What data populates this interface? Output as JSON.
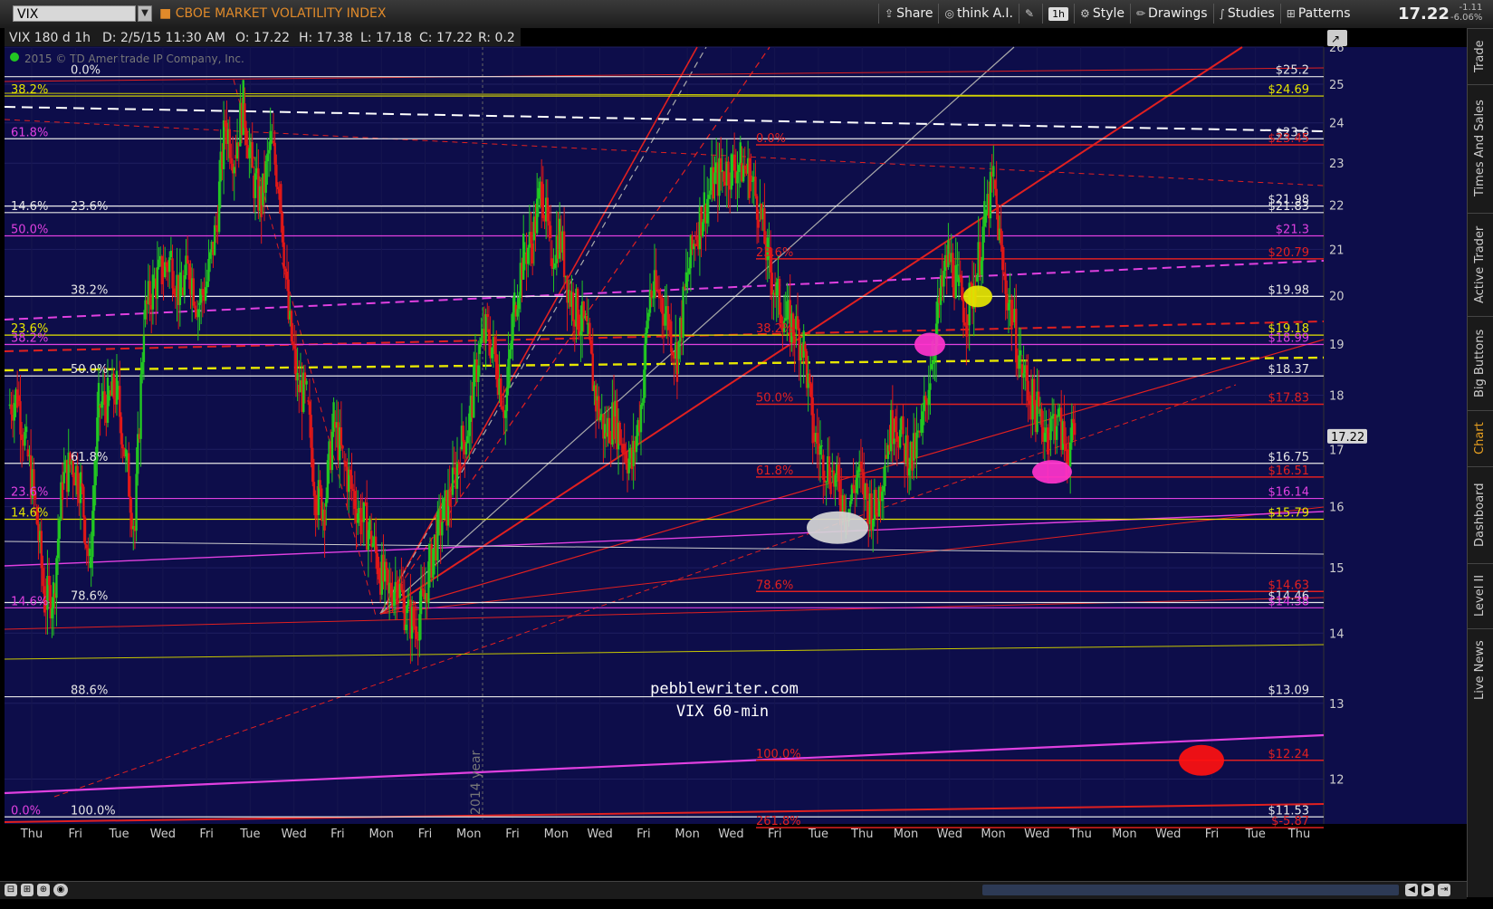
{
  "toolbar": {
    "symbol": "VIX",
    "instrument_name": "CBOE MARKET VOLATILITY INDEX",
    "buttons": [
      {
        "icon": "share-icon",
        "label": "Share"
      },
      {
        "icon": "bulb-icon",
        "label": "think A.I."
      },
      {
        "icon": "wrench-icon",
        "label": ""
      },
      {
        "icon": "timeframe-icon",
        "label": "1h"
      },
      {
        "icon": "style-icon",
        "label": "Style"
      },
      {
        "icon": "pencil-icon",
        "label": "Drawings"
      },
      {
        "icon": "studies-icon",
        "label": "Studies"
      },
      {
        "icon": "patterns-icon",
        "label": "Patterns"
      }
    ],
    "last_price": "17.22",
    "net_change": "-1.11",
    "net_change_pct": "-6.06%"
  },
  "info_bar": {
    "aggregation": "VIX 180 d 1h",
    "date": "D: 2/5/15 11:30 AM",
    "open": "O: 17.22",
    "high": "H: 17.38",
    "low": "L: 17.18",
    "close": "C: 17.22",
    "range": "R: 0.2"
  },
  "copyright": "2015 © TD Ameritrade IP Company, Inc.",
  "watermark": {
    "line1": "pebblewriter.com",
    "line2": "VIX 60-min"
  },
  "year_marker": "2014 year",
  "right_tabs": [
    "Trade",
    "Times And Sales",
    "Active Trader",
    "Big Buttons",
    "Chart",
    "Dashboard",
    "Level II",
    "Live News"
  ],
  "colors": {
    "background": "#0d0d4a",
    "up": "#22c722",
    "down": "#e01818",
    "fib_white": "#e6e6e6",
    "fib_magenta": "#e040e0",
    "fib_yellow": "#e6e600",
    "fib_red": "#e02020",
    "price_badge": "#d8d8d8"
  },
  "chart_data": {
    "type": "candlestick",
    "title": "CBOE MARKET VOLATILITY INDEX",
    "timeframe": "180 d 1h",
    "ylim": [
      11.5,
      26.0
    ],
    "y_scale": "log",
    "y_ticks": [
      12,
      13,
      14,
      15,
      16,
      17,
      18,
      19,
      20,
      21,
      22,
      23,
      24,
      25,
      26
    ],
    "current_price": 17.22,
    "x_tick_labels": [
      "Thu",
      "Fri",
      "Tue",
      "Wed",
      "Fri",
      "Tue",
      "Wed",
      "Fri",
      "Mon",
      "Fri",
      "Mon",
      "Fri",
      "Mon",
      "Wed",
      "Fri",
      "Mon",
      "Wed",
      "Fri",
      "Tue",
      "Thu",
      "Mon",
      "Wed",
      "Mon",
      "Wed",
      "Thu",
      "Mon",
      "Wed",
      "Fri",
      "Tue",
      "Thu"
    ],
    "price_path": [
      [
        0,
        17.8
      ],
      [
        1,
        18.0
      ],
      [
        2,
        17.0
      ],
      [
        3,
        16.0
      ],
      [
        4,
        14.5
      ],
      [
        5,
        14.6
      ],
      [
        6,
        16.4
      ],
      [
        7,
        16.8
      ],
      [
        8,
        16.4
      ],
      [
        9,
        15.0
      ],
      [
        10,
        17.8
      ],
      [
        11,
        17.9
      ],
      [
        12,
        18.1
      ],
      [
        13,
        16.8
      ],
      [
        14,
        15.6
      ],
      [
        15,
        19.5
      ],
      [
        16,
        20.2
      ],
      [
        17,
        20.5
      ],
      [
        18,
        20.8
      ],
      [
        19,
        20.0
      ],
      [
        20,
        20.6
      ],
      [
        21,
        19.8
      ],
      [
        22,
        20.3
      ],
      [
        23,
        21.5
      ],
      [
        24,
        24.0
      ],
      [
        25,
        23.2
      ],
      [
        26,
        24.5
      ],
      [
        27,
        22.7
      ],
      [
        28,
        22.0
      ],
      [
        29,
        23.5
      ],
      [
        30,
        22.5
      ],
      [
        31,
        19.5
      ],
      [
        32,
        18.2
      ],
      [
        33,
        17.9
      ],
      [
        34,
        16.2
      ],
      [
        35,
        16.0
      ],
      [
        36,
        17.5
      ],
      [
        37,
        16.8
      ],
      [
        38,
        16.3
      ],
      [
        39,
        15.8
      ],
      [
        40,
        15.6
      ],
      [
        41,
        15.0
      ],
      [
        42,
        14.6
      ],
      [
        43,
        14.8
      ],
      [
        44,
        14.3
      ],
      [
        45,
        14.1
      ],
      [
        46,
        14.5
      ],
      [
        47,
        15.3
      ],
      [
        48,
        15.8
      ],
      [
        49,
        16.2
      ],
      [
        50,
        17.0
      ],
      [
        51,
        17.5
      ],
      [
        52,
        18.8
      ],
      [
        53,
        19.3
      ],
      [
        54,
        18.6
      ],
      [
        55,
        17.7
      ],
      [
        56,
        19.8
      ],
      [
        57,
        20.9
      ],
      [
        58,
        21.2
      ],
      [
        59,
        22.5
      ],
      [
        60,
        20.8
      ],
      [
        61,
        21.4
      ],
      [
        62,
        20.1
      ],
      [
        63,
        19.6
      ],
      [
        64,
        19.2
      ],
      [
        65,
        17.9
      ],
      [
        66,
        17.3
      ],
      [
        67,
        17.6
      ],
      [
        68,
        17.1
      ],
      [
        69,
        16.7
      ],
      [
        70,
        17.8
      ],
      [
        71,
        20.1
      ],
      [
        72,
        20.0
      ],
      [
        73,
        19.5
      ],
      [
        74,
        18.7
      ],
      [
        75,
        20.3
      ],
      [
        76,
        21.3
      ],
      [
        77,
        22.0
      ],
      [
        78,
        22.5
      ],
      [
        79,
        22.8
      ],
      [
        80,
        22.9
      ],
      [
        81,
        23.0
      ],
      [
        82,
        22.7
      ],
      [
        83,
        22.0
      ],
      [
        84,
        20.8
      ],
      [
        85,
        20.0
      ],
      [
        86,
        19.5
      ],
      [
        87,
        19.3
      ],
      [
        88,
        19.0
      ],
      [
        89,
        17.3
      ],
      [
        90,
        16.9
      ],
      [
        91,
        16.6
      ],
      [
        92,
        16.2
      ],
      [
        93,
        16.0
      ],
      [
        94,
        16.6
      ],
      [
        95,
        16.1
      ],
      [
        96,
        15.9
      ],
      [
        97,
        16.9
      ],
      [
        98,
        17.6
      ],
      [
        99,
        17.1
      ],
      [
        100,
        16.8
      ],
      [
        101,
        17.3
      ],
      [
        102,
        18.5
      ],
      [
        103,
        19.8
      ],
      [
        104,
        20.9
      ],
      [
        105,
        20.2
      ],
      [
        106,
        19.6
      ],
      [
        107,
        20.3
      ],
      [
        108,
        21.6
      ],
      [
        109,
        22.6
      ],
      [
        110,
        20.5
      ],
      [
        111,
        19.6
      ],
      [
        112,
        18.6
      ],
      [
        113,
        18.0
      ],
      [
        114,
        17.6
      ],
      [
        115,
        17.3
      ],
      [
        116,
        17.6
      ],
      [
        117,
        17.0
      ],
      [
        118,
        17.22
      ]
    ],
    "price_path_x_domain": [
      0,
      118
    ],
    "horizontal_levels": [
      {
        "value": 25.2,
        "label": "$25.2",
        "color": "white"
      },
      {
        "value": 24.69,
        "label": "$24.69",
        "color": "yellow"
      },
      {
        "value": 23.6,
        "label": "$23.6",
        "color": "white"
      },
      {
        "value": 23.45,
        "label": "$23.45",
        "color": "red"
      },
      {
        "value": 21.98,
        "label": "$21.98",
        "color": "white"
      },
      {
        "value": 21.83,
        "label": "$21.83",
        "color": "white"
      },
      {
        "value": 21.3,
        "label": "$21.3",
        "color": "magenta"
      },
      {
        "value": 20.79,
        "label": "$20.79",
        "color": "red"
      },
      {
        "value": 19.98,
        "label": "$19.98",
        "color": "white"
      },
      {
        "value": 19.18,
        "label": "$19.18",
        "color": "yellow"
      },
      {
        "value": 18.99,
        "label": "$18.99",
        "color": "magenta"
      },
      {
        "value": 18.37,
        "label": "$18.37",
        "color": "white"
      },
      {
        "value": 17.83,
        "label": "$17.83",
        "color": "red"
      },
      {
        "value": 16.75,
        "label": "$16.75",
        "color": "white"
      },
      {
        "value": 16.51,
        "label": "$16.51",
        "color": "red"
      },
      {
        "value": 16.14,
        "label": "$16.14",
        "color": "magenta"
      },
      {
        "value": 15.79,
        "label": "$15.79",
        "color": "yellow"
      },
      {
        "value": 14.63,
        "label": "$14.63",
        "color": "red"
      },
      {
        "value": 14.46,
        "label": "$14.46",
        "color": "white"
      },
      {
        "value": 14.38,
        "label": "$14.38",
        "color": "magenta"
      },
      {
        "value": 13.09,
        "label": "$13.09",
        "color": "white"
      },
      {
        "value": 12.24,
        "label": "$12.24",
        "color": "red"
      },
      {
        "value": 11.53,
        "label": "$11.53",
        "color": "white"
      },
      {
        "value": 11.4,
        "label": "$-5.87",
        "color": "red"
      }
    ],
    "fib_labels": [
      {
        "label": "0.0%",
        "value": 25.2,
        "color": "white"
      },
      {
        "label": "23.6%",
        "value": 21.83,
        "color": "white"
      },
      {
        "label": "38.2%",
        "value": 19.98,
        "color": "white"
      },
      {
        "label": "50.0%",
        "value": 18.37,
        "color": "white"
      },
      {
        "label": "61.8%",
        "value": 16.75,
        "color": "white"
      },
      {
        "label": "78.6%",
        "value": 14.46,
        "color": "white"
      },
      {
        "label": "88.6%",
        "value": 13.09,
        "color": "white"
      },
      {
        "label": "100.0%",
        "value": 11.53,
        "color": "white"
      },
      {
        "label": "38.2%",
        "value": 24.69,
        "color": "yellow"
      },
      {
        "label": "14.6%",
        "value": 15.79,
        "color": "yellow"
      },
      {
        "label": "23.6%",
        "value": 19.18,
        "color": "yellow"
      },
      {
        "label": "61.8%",
        "value": 23.6,
        "color": "magenta"
      },
      {
        "label": "14.6%",
        "value": 21.83,
        "color": "white"
      },
      {
        "label": "50.0%",
        "value": 21.3,
        "color": "magenta"
      },
      {
        "label": "38.2%",
        "value": 18.99,
        "color": "magenta"
      },
      {
        "label": "23.6%",
        "value": 16.14,
        "color": "magenta"
      },
      {
        "label": "14.6%",
        "value": 14.38,
        "color": "magenta"
      },
      {
        "label": "0.0%",
        "value": 11.53,
        "color": "magenta"
      },
      {
        "label": "0.0%",
        "value": 23.45,
        "color": "red"
      },
      {
        "label": "23.6%",
        "value": 20.79,
        "color": "red"
      },
      {
        "label": "38.2%",
        "value": 19.18,
        "color": "red"
      },
      {
        "label": "50.0%",
        "value": 17.83,
        "color": "red"
      },
      {
        "label": "61.8%",
        "value": 16.51,
        "color": "red"
      },
      {
        "label": "78.6%",
        "value": 14.63,
        "color": "red"
      },
      {
        "label": "100.0%",
        "value": 12.24,
        "color": "red"
      },
      {
        "label": "261.8%",
        "value": 11.4,
        "color": "red"
      }
    ],
    "markers": [
      {
        "color": "white",
        "value": 15.65,
        "note": "ellipse"
      },
      {
        "color": "magenta",
        "value": 18.99,
        "note": "ellipse"
      },
      {
        "color": "yellow",
        "value": 19.98,
        "note": "ellipse"
      },
      {
        "color": "magenta",
        "value": 16.6,
        "note": "ellipse"
      },
      {
        "color": "red",
        "value": 12.24,
        "note": "circle"
      }
    ]
  }
}
